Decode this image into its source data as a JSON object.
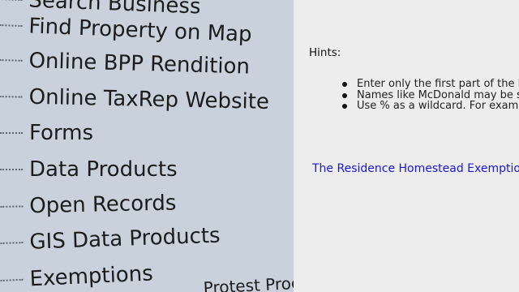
{
  "sidebar": {
    "items": [
      {
        "label": "Search Business"
      },
      {
        "label": "Find Property on Map"
      },
      {
        "label": "Online BPP Rendition"
      },
      {
        "label": "Online TaxRep Website"
      },
      {
        "label": "Forms"
      },
      {
        "label": "Data Products"
      },
      {
        "label": "Open Records"
      },
      {
        "label": "GIS Data Products"
      },
      {
        "label": "Exemptions"
      },
      {
        "label": "Protest Process"
      }
    ]
  },
  "main": {
    "hints_label": "Hints:",
    "hints": [
      "Enter only the first part of the last name.",
      "Names like McDonald may be spelled differently.",
      "Use % as a wildcard. For example"
    ],
    "link": "The Residence Homestead Exemption Application"
  }
}
